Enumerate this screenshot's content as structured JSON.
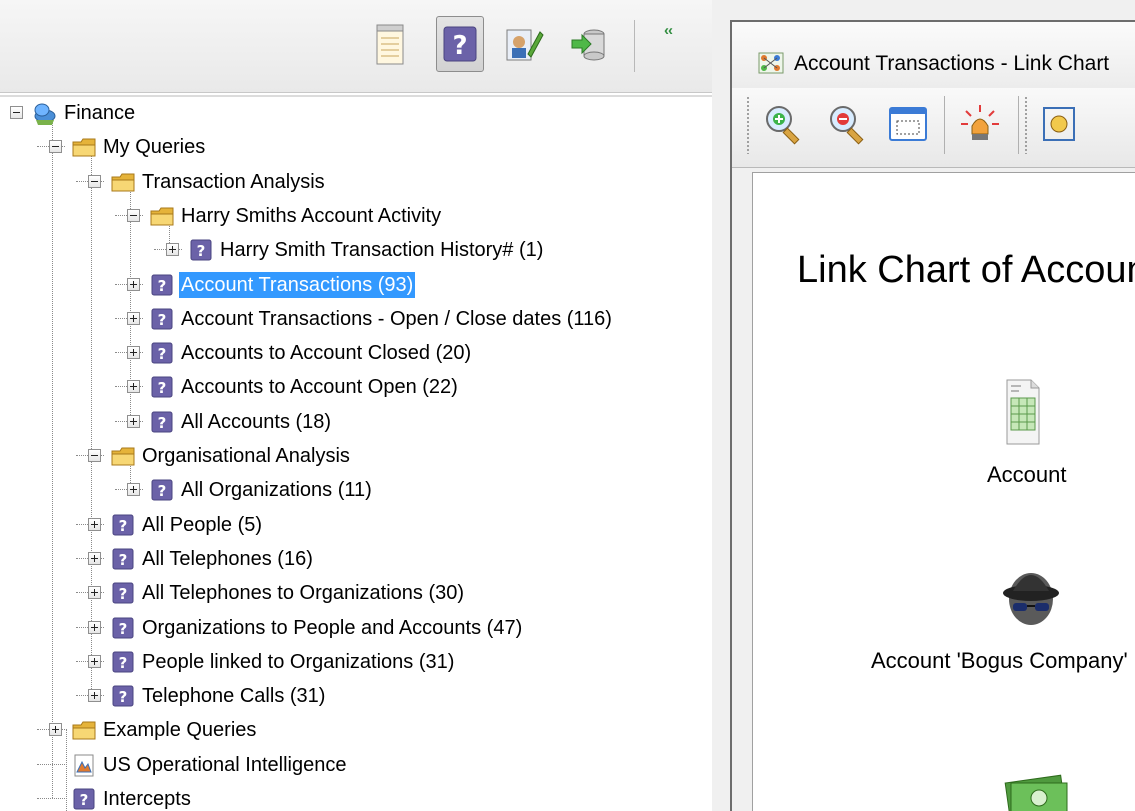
{
  "left_toolbar": {
    "buttons": [
      {
        "name": "notepad-icon",
        "label": ""
      },
      {
        "name": "query-icon",
        "label": ""
      },
      {
        "name": "edit-icon",
        "label": ""
      },
      {
        "name": "database-import-icon",
        "label": ""
      }
    ],
    "collapse_label": "‹‹"
  },
  "tree": {
    "nodes": [
      {
        "label": "Finance",
        "icon": "finance-icon",
        "expander": "minus"
      },
      {
        "label": "My Queries",
        "icon": "folder-icon",
        "expander": "minus"
      },
      {
        "label": "Transaction Analysis",
        "icon": "folder-icon",
        "expander": "minus"
      },
      {
        "label": "Harry Smiths Account Activity",
        "icon": "folder-icon",
        "expander": "minus"
      },
      {
        "label": "Harry Smith Transaction History# (1)",
        "icon": "query-icon",
        "expander": "plus"
      },
      {
        "label": "Account Transactions (93)",
        "icon": "query-icon",
        "expander": "plus",
        "selected": true
      },
      {
        "label": "Account Transactions - Open / Close dates (116)",
        "icon": "query-icon",
        "expander": "plus"
      },
      {
        "label": "Accounts to Account Closed (20)",
        "icon": "query-icon",
        "expander": "plus"
      },
      {
        "label": "Accounts to Account Open (22)",
        "icon": "query-icon",
        "expander": "plus"
      },
      {
        "label": "All Accounts (18)",
        "icon": "query-icon",
        "expander": "plus"
      },
      {
        "label": "Organisational Analysis",
        "icon": "folder-icon",
        "expander": "minus"
      },
      {
        "label": "All Organizations (11)",
        "icon": "query-icon",
        "expander": "plus"
      },
      {
        "label": "All People (5)",
        "icon": "query-icon",
        "expander": "plus"
      },
      {
        "label": "All Telephones (16)",
        "icon": "query-icon",
        "expander": "plus"
      },
      {
        "label": "All Telephones to Organizations (30)",
        "icon": "query-icon",
        "expander": "plus"
      },
      {
        "label": "Organizations to People and Accounts (47)",
        "icon": "query-icon",
        "expander": "plus"
      },
      {
        "label": "People linked to Organizations (31)",
        "icon": "query-icon",
        "expander": "plus"
      },
      {
        "label": "Telephone Calls (31)",
        "icon": "query-icon",
        "expander": "plus"
      },
      {
        "label": "Example Queries",
        "icon": "folder-icon",
        "expander": "plus"
      },
      {
        "label": "US Operational Intelligence",
        "icon": "report-icon",
        "expander": "none"
      },
      {
        "label": "Intercepts",
        "icon": "query-icon",
        "expander": "none"
      }
    ]
  },
  "chart_window": {
    "title": "Account Transactions - Link Chart",
    "toolbar": [
      {
        "name": "zoom-in-icon"
      },
      {
        "name": "zoom-out-icon"
      },
      {
        "name": "fit-window-icon"
      },
      {
        "name": "highlight-icon"
      },
      {
        "name": "layout-icon"
      }
    ],
    "heading": "Link Chart of Account Transactions",
    "entities": [
      {
        "label": "Account",
        "icon": "spreadsheet-icon"
      },
      {
        "label": "Account 'Bogus Company'",
        "icon": "spy-icon"
      },
      {
        "label": "",
        "icon": "money-icon"
      }
    ]
  },
  "colors": {
    "selection": "#3399ff",
    "folder": "#f2c94c",
    "query_icon": "#6b62a8"
  }
}
